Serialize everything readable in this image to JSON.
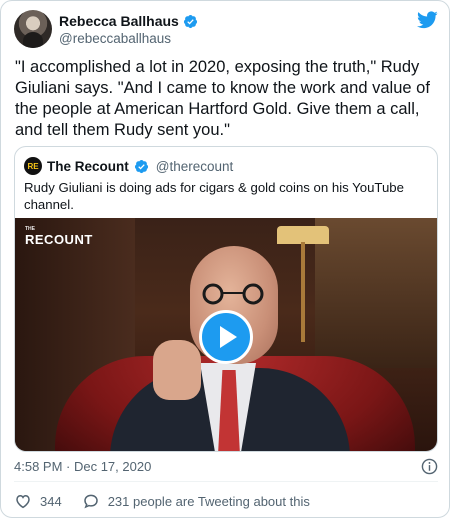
{
  "author": {
    "name": "Rebecca Ballhaus",
    "handle": "@rebeccaballhaus"
  },
  "tweet": {
    "text": "\"I accomplished a lot in 2020, exposing the truth,\" Rudy Giuliani says. \"And I came to know the work and value of the people at American Hartford Gold. Give them a call, and tell them Rudy sent you.\"",
    "timestamp": "4:58 PM · Dec 17, 2020"
  },
  "quoted": {
    "avatar_initials": "RE",
    "name": "The Recount",
    "handle": "@therecount",
    "text": "Rudy Giuliani is doing ads for cigars & gold coins on his YouTube channel.",
    "video_logo": "RECOUNT",
    "video_logo_prefix": "THE"
  },
  "actions": {
    "likes": "344",
    "conversation": "231 people are Tweeting about this"
  },
  "colors": {
    "accent": "#1d9bf0",
    "text": "#0f1419",
    "secondary": "#536471",
    "border": "#cfd9de"
  },
  "icons": {
    "verified": "verified-badge-icon",
    "twitter": "twitter-bird-icon",
    "info": "info-icon",
    "like": "heart-icon",
    "reply": "speech-bubble-icon",
    "play": "play-icon"
  }
}
